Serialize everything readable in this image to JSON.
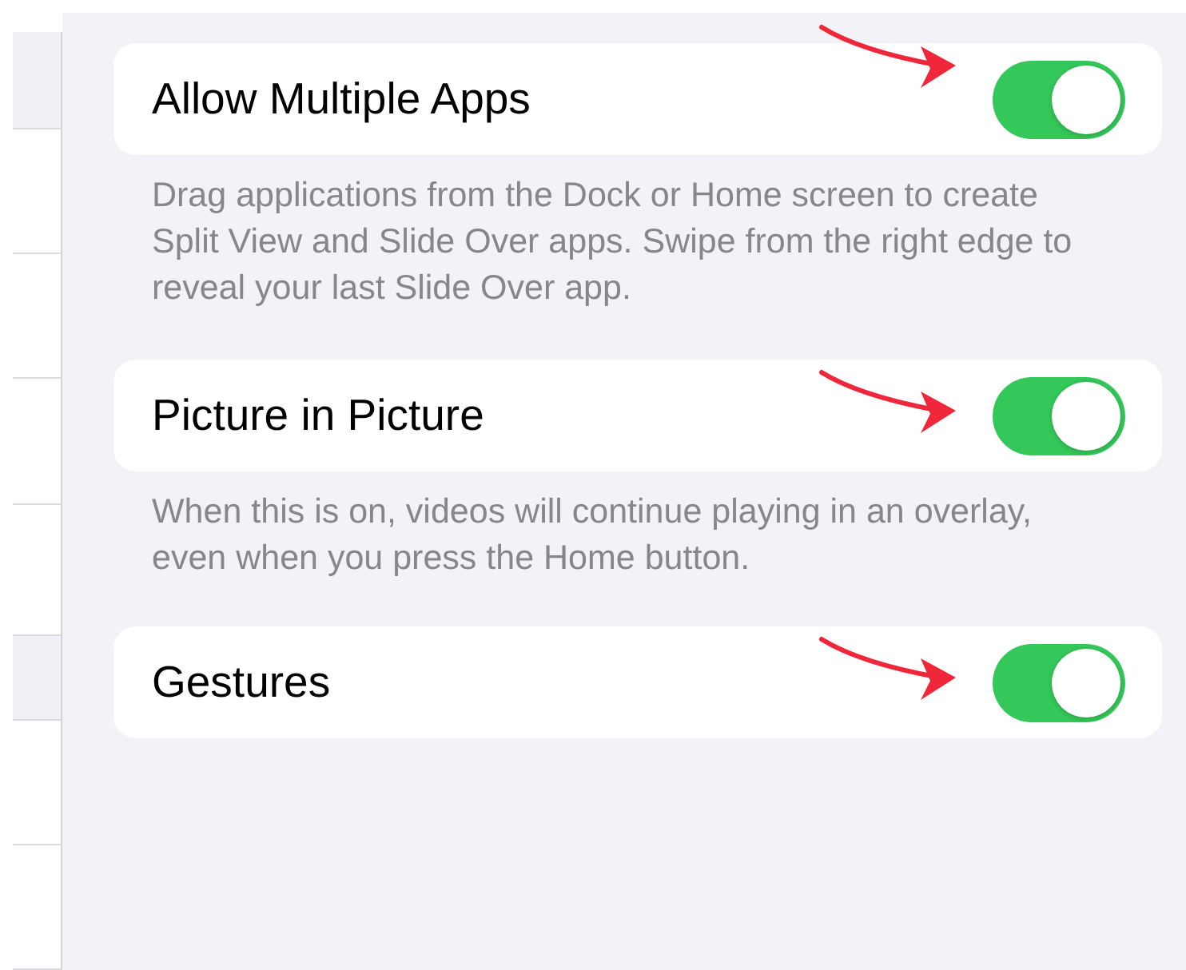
{
  "settings": [
    {
      "label": "Allow Multiple Apps",
      "on": true,
      "description": "Drag applications from the Dock or Home screen to create Split View and Slide Over apps. Swipe from the right edge to reveal your last Slide Over app."
    },
    {
      "label": "Picture in Picture",
      "on": true,
      "description": "When this is on, videos will continue playing in an overlay, even when you press the Home button."
    },
    {
      "label": "Gestures",
      "on": true
    }
  ]
}
